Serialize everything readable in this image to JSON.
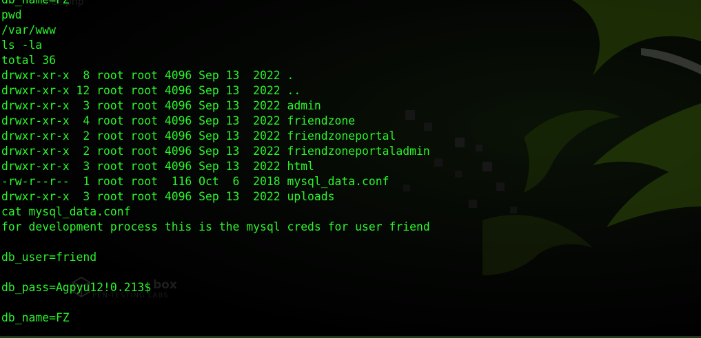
{
  "terminal": {
    "lines": [
      "db_name=FZ",
      "pwd",
      "/var/www",
      "ls -la",
      "total 36",
      "drwxr-xr-x  8 root root 4096 Sep 13  2022 .",
      "drwxr-xr-x 12 root root 4096 Sep 13  2022 ..",
      "drwxr-xr-x  3 root root 4096 Sep 13  2022 admin",
      "drwxr-xr-x  4 root root 4096 Sep 13  2022 friendzone",
      "drwxr-xr-x  2 root root 4096 Sep 13  2022 friendzoneportal",
      "drwxr-xr-x  2 root root 4096 Sep 13  2022 friendzoneportaladmin",
      "drwxr-xr-x  3 root root 4096 Sep 13  2022 html",
      "-rw-r--r--  1 root root  116 Oct  6  2018 mysql_data.conf",
      "drwxr-xr-x  3 root root 4096 Sep 13  2022 uploads",
      "cat mysql_data.conf",
      "for development process this is the mysql creds for user friend",
      "",
      "db_user=friend",
      "",
      "db_pass=Agpyu12!0.213$",
      "",
      "db_name=FZ"
    ]
  },
  "wallpaper": {
    "ghost_filename": "shell.php",
    "ghost_logo_top": "box",
    "ghost_logo_bottom": "PEN-TESTING LABS",
    "accent": "#a8d20a",
    "text_color": "#2af52a"
  }
}
